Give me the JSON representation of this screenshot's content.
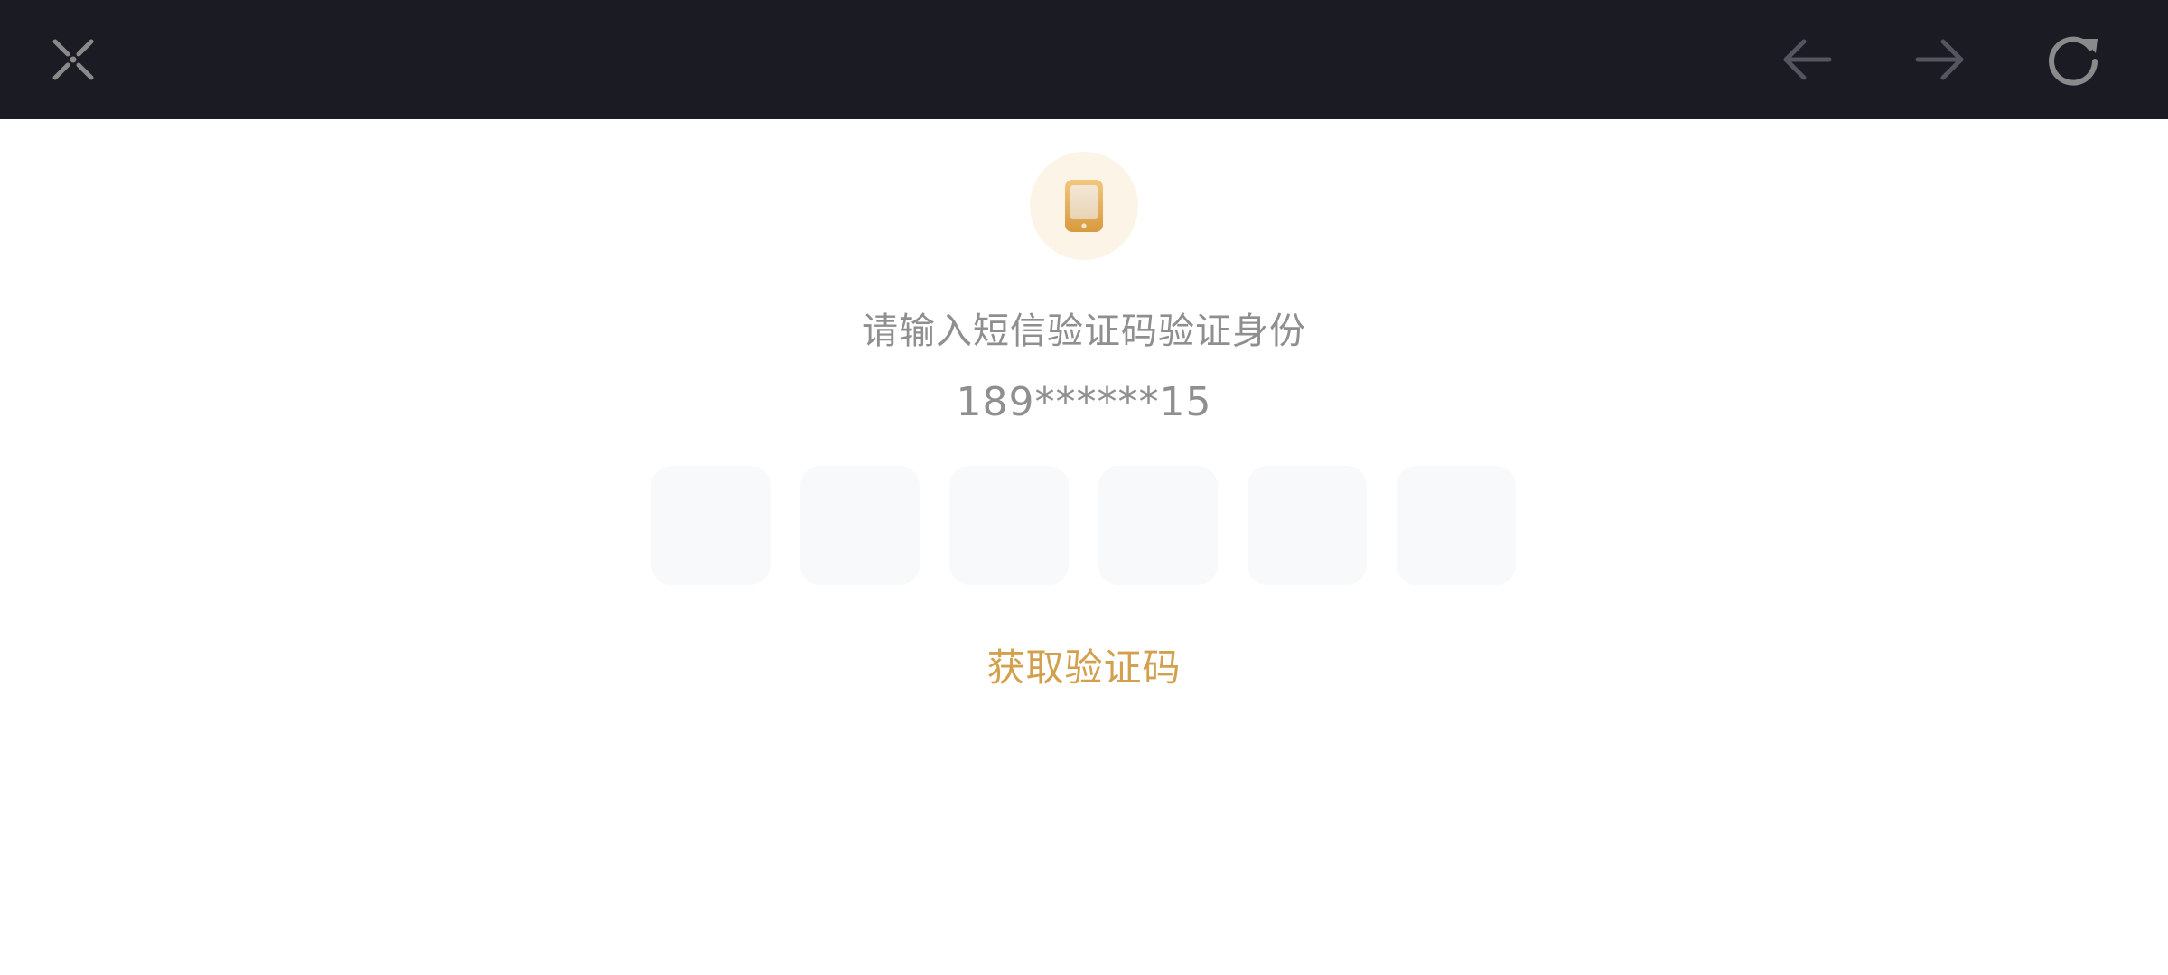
{
  "toolbar": {
    "close_icon": "close-icon",
    "back_icon": "arrow-left-icon",
    "forward_icon": "arrow-right-icon",
    "refresh_icon": "refresh-icon"
  },
  "verification": {
    "badge_icon": "phone-icon",
    "prompt": "请输入短信验证码验证身份",
    "phone_masked": "189******15",
    "code_length": 6,
    "get_code_label": "获取验证码"
  },
  "colors": {
    "topbar_bg": "#1b1b24",
    "icon_gray": "#8a8a8a",
    "icon_disabled": "#555560",
    "badge_bg": "#fdf4e8",
    "accent": "#d3a04d",
    "muted_text": "#8f8f8f",
    "code_box_bg": "#f8f9fb"
  }
}
